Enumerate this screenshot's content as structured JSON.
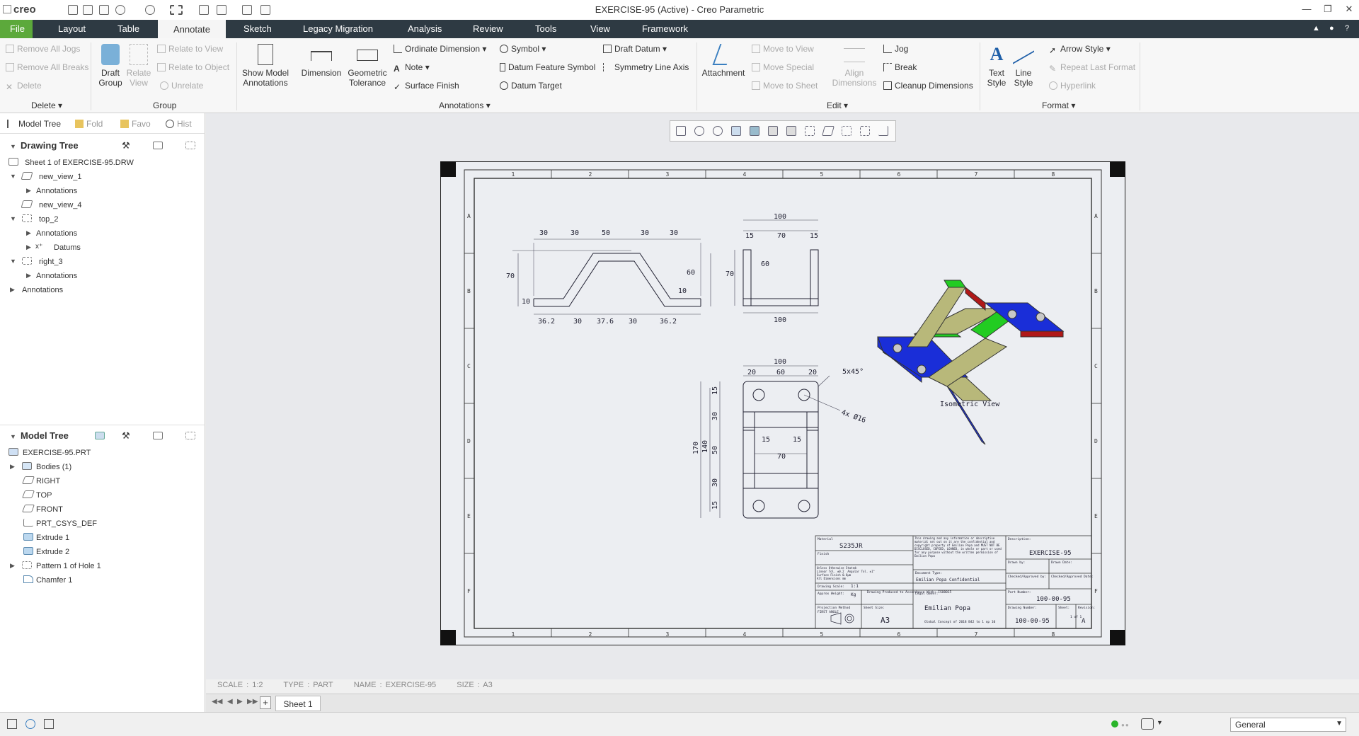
{
  "app": {
    "logo": "creo",
    "window_title": "EXERCISE-95 (Active) - Creo Parametric"
  },
  "menu": {
    "file": "File",
    "tabs": [
      "Layout",
      "Table",
      "Annotate",
      "Sketch",
      "Legacy Migration",
      "Analysis",
      "Review",
      "Tools",
      "View",
      "Framework"
    ]
  },
  "ribbon": {
    "delete": {
      "items": [
        "Remove All Jogs",
        "Remove All Breaks",
        "Delete"
      ],
      "label": "Delete"
    },
    "group": {
      "draft_group": "Draft\nGroup",
      "relate_view": "Relate\nView",
      "relate_to_view": "Relate to View",
      "relate_to_object": "Relate to Object",
      "unrelate": "Unrelate",
      "label": "Group"
    },
    "annotations": {
      "show_model": "Show Model\nAnnotations",
      "dimension": "Dimension",
      "geom_tol": "Geometric\nTolerance",
      "ordinate": "Ordinate Dimension",
      "note": "Note",
      "surface_finish": "Surface Finish",
      "symbol": "Symbol",
      "datum_feature": "Datum Feature Symbol",
      "datum_target": "Datum Target",
      "draft_datum": "Draft Datum",
      "symmetry": "Symmetry Line Axis",
      "label": "Annotations"
    },
    "edit": {
      "attachment": "Attachment",
      "move_to_view": "Move to View",
      "move_special": "Move Special",
      "move_to_sheet": "Move to Sheet",
      "align": "Align\nDimensions",
      "jog": "Jog",
      "break": "Break",
      "cleanup": "Cleanup Dimensions",
      "label": "Edit"
    },
    "format": {
      "text_style": "Text\nStyle",
      "line_style": "Line\nStyle",
      "arrow_style": "Arrow Style",
      "repeat_last": "Repeat Last Format",
      "hyperlink": "Hyperlink",
      "label": "Format"
    }
  },
  "panel": {
    "tabs": [
      "Model Tree",
      "Fold",
      "Favo",
      "Hist"
    ]
  },
  "drawing_tree": {
    "title": "Drawing Tree",
    "items": [
      "Sheet 1 of EXERCISE-95.DRW",
      "new_view_1",
      "Annotations",
      "new_view_4",
      "top_2",
      "Annotations",
      "Datums",
      "right_3",
      "Annotations",
      "Annotations"
    ]
  },
  "model_tree": {
    "title": "Model Tree",
    "items": [
      "EXERCISE-95.PRT",
      "Bodies (1)",
      "RIGHT",
      "TOP",
      "FRONT",
      "PRT_CSYS_DEF",
      "Extrude 1",
      "Extrude 2",
      "Pattern 1 of Hole 1",
      "Chamfer 1"
    ]
  },
  "status": {
    "scale": "SCALE : 1:2",
    "type": "TYPE : PART",
    "name": "NAME : EXERCISE-95",
    "size": "SIZE : A3"
  },
  "sheets": {
    "current": "Sheet 1"
  },
  "filter": {
    "value": "General"
  },
  "drawing": {
    "col_labels": [
      "1",
      "2",
      "3",
      "4",
      "5",
      "6",
      "7",
      "8"
    ],
    "row_labels": [
      "A",
      "B",
      "C",
      "D",
      "E",
      "F"
    ],
    "front_dims_top": [
      "30",
      "30",
      "50",
      "30",
      "30"
    ],
    "front_dims_bottom": [
      "36.2",
      "30",
      "37.6",
      "30",
      "36.2"
    ],
    "front_dims_side": [
      "70",
      "10",
      "60",
      "10"
    ],
    "side_dims": [
      "100",
      "15",
      "70",
      "15",
      "70",
      "60",
      "100"
    ],
    "top_dims": [
      "100",
      "20",
      "60",
      "20",
      "15",
      "15",
      "70",
      "170",
      "140",
      "15",
      "30",
      "50",
      "30",
      "15"
    ],
    "chamfer_note": "5x45°",
    "hole_note": "4x Ø16",
    "iso_label": "Isometric View",
    "colors": {
      "iso_base": "#1a2ed8",
      "iso_wall": "#b8b87a",
      "iso_top": "#22cc22",
      "iso_red": "#b01818"
    },
    "title_block": {
      "material_label": "Material",
      "material": "S235JR",
      "finish_label": "Finish",
      "tolerances": "Unless Otherwise Stated:\nLinear Tol. ±0.2  Angular Tol. ±1°\nSurface Finish 0.8µm\nAll Dimensions mm",
      "confidential_text": "This drawing and any information or descriptive material set out on it are the confidential and copyright property of Emilian Popa and MUST NOT BE DISCLOSED, COPIED, LOANED, in whole or part or used for any purpose without the written permission of Emilian Popa",
      "doc_type_label": "Document Type:",
      "scale_label": "Drawing Scale:",
      "scale": "1:1",
      "weight_label": "Approx Weight:",
      "weight": "Kg",
      "produced": "Drawing Produced to Accordance With: ISO8015",
      "owner_note": "Emilian Popa Confidential",
      "legal_label": "Legal Owner:",
      "owner": "Emilian Popa",
      "owner_sub": "Global Concept of 2018 B42 to 1 op 10",
      "projection_label": "Projection Method",
      "projection": "FIRST ANGLE",
      "sheet_size_label": "Sheet Size:",
      "sheet_size": "A3",
      "desc_label": "Description:",
      "desc": "EXERCISE-95",
      "drawn_label": "Drawn by:",
      "drawn_date_label": "Drawn Date:",
      "checked_label": "Checked/Approved by:",
      "checked_date_label": "Checked/Approved Date:",
      "part_label": "Part Number:",
      "part_no": "100-00-95",
      "drawing_no_label": "Drawing Number:",
      "drawing_no": "100-00-95",
      "sheet_label": "Sheet:",
      "sheet": "1 of 1",
      "rev_label": "Revision:",
      "rev": "A"
    }
  }
}
